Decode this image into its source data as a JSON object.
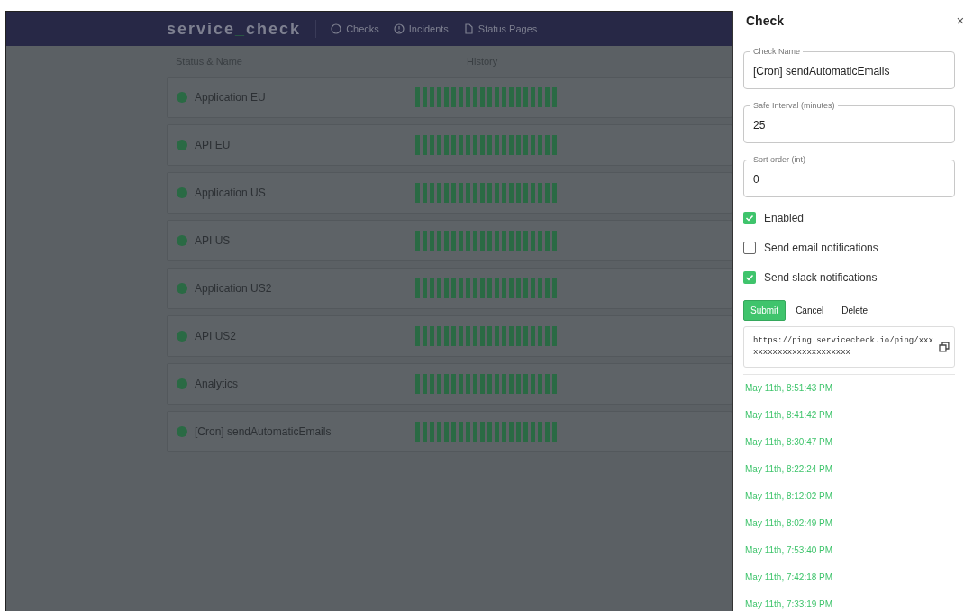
{
  "nav": {
    "logo_prefix": "service",
    "logo_sep": "_",
    "logo_suffix": "check",
    "links": [
      {
        "kind": "circle",
        "label": "Checks"
      },
      {
        "kind": "alert",
        "label": "Incidents"
      },
      {
        "kind": "page",
        "label": "Status Pages"
      }
    ]
  },
  "table": {
    "columns": [
      "Status & Name",
      "History"
    ],
    "rows": [
      {
        "name": "Application EU"
      },
      {
        "name": "API EU"
      },
      {
        "name": "Application US"
      },
      {
        "name": "API US"
      },
      {
        "name": "Application US2"
      },
      {
        "name": "API US2"
      },
      {
        "name": "Analytics"
      },
      {
        "name": "[Cron] sendAutomaticEmails"
      }
    ]
  },
  "drawer": {
    "title": "Check",
    "close": "×",
    "fields": [
      {
        "label": "Check Name",
        "value": "[Cron] sendAutomaticEmails"
      },
      {
        "label": "Safe Interval (minutes)",
        "value": "25"
      },
      {
        "label": "Sort order (int)",
        "value": "0"
      }
    ],
    "checkboxes": [
      {
        "label": "Enabled",
        "checked": true
      },
      {
        "label": "Send email notifications",
        "checked": false
      },
      {
        "label": "Send slack notifications",
        "checked": true
      }
    ],
    "buttons": [
      {
        "kind": "primary",
        "label": "Submit"
      },
      {
        "kind": "plain",
        "label": "Cancel"
      },
      {
        "kind": "plain",
        "label": "Delete"
      }
    ],
    "ping_url": "https://ping.servicecheck.io/ping/xxxxxxxxxxxxxxxxxxxxxxx",
    "pings": [
      "May 11th, 8:51:43 PM",
      "May 11th, 8:41:42 PM",
      "May 11th, 8:30:47 PM",
      "May 11th, 8:22:24 PM",
      "May 11th, 8:12:02 PM",
      "May 11th, 8:02:49 PM",
      "May 11th, 7:53:40 PM",
      "May 11th, 7:42:18 PM",
      "May 11th, 7:33:19 PM"
    ]
  }
}
